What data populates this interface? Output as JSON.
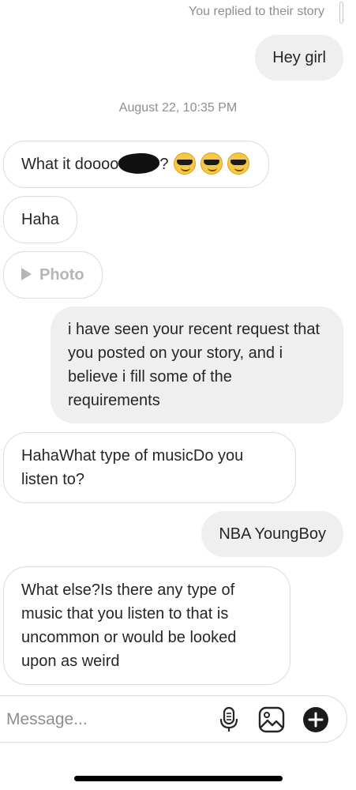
{
  "story_reply_note": "You replied to their story",
  "timestamp": "August 22, 10:35 PM",
  "messages": {
    "m1": "Hey girl",
    "m2_prefix": "What it doooo",
    "m2_suffix": "?",
    "m3": "Haha",
    "m4": "Photo",
    "m5": "i have seen your recent request that you posted on your story, and i believe i fill some of the requirements",
    "m6": "HahaWhat type of musicDo you listen to?",
    "m7": "NBA YoungBoy",
    "m8": "What else?Is there any type of music that you listen to that is uncommon or would be looked upon as weird"
  },
  "icons": {
    "emoji": "sunglasses-emoji",
    "play": "play-icon",
    "mic": "microphone-icon",
    "gallery": "gallery-icon",
    "plus": "plus-icon"
  },
  "composer": {
    "placeholder": "Message...",
    "value": ""
  },
  "colors": {
    "outgoing_bubble": "#efefef",
    "incoming_border": "#dbdbdb",
    "muted_text": "#8e8e8e"
  }
}
